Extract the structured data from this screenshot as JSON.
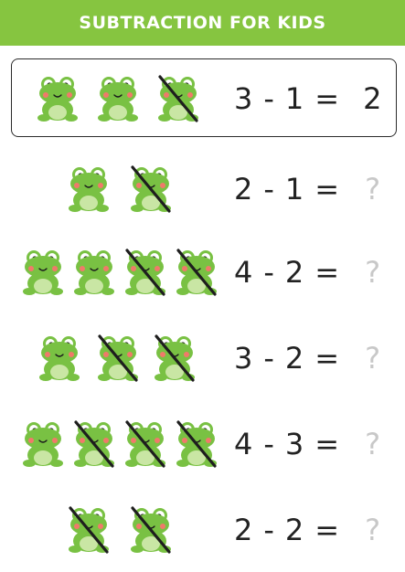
{
  "header": {
    "title": "SUBTRACTION FOR KIDS"
  },
  "colors": {
    "header": "#86c540",
    "frog_body": "#79c143",
    "frog_belly": "#c9e6a4",
    "cross": "#1e1e1e",
    "question": "#c8c8c8"
  },
  "icons": {
    "frog": "frog-icon",
    "cross": "strike-line"
  },
  "rows": [
    {
      "a": "3",
      "minus": "-",
      "b": "1",
      "equals": "=",
      "result": "2",
      "frogs": 3,
      "crossed": 1,
      "example": true
    },
    {
      "a": "2",
      "minus": "-",
      "b": "1",
      "equals": "=",
      "result": "?",
      "frogs": 2,
      "crossed": 1
    },
    {
      "a": "4",
      "minus": "-",
      "b": "2",
      "equals": "=",
      "result": "?",
      "frogs": 4,
      "crossed": 2
    },
    {
      "a": "3",
      "minus": "-",
      "b": "2",
      "equals": "=",
      "result": "?",
      "frogs": 3,
      "crossed": 2
    },
    {
      "a": "4",
      "minus": "-",
      "b": "3",
      "equals": "=",
      "result": "?",
      "frogs": 4,
      "crossed": 3
    },
    {
      "a": "2",
      "minus": "-",
      "b": "2",
      "equals": "=",
      "result": "?",
      "frogs": 2,
      "crossed": 2
    }
  ]
}
